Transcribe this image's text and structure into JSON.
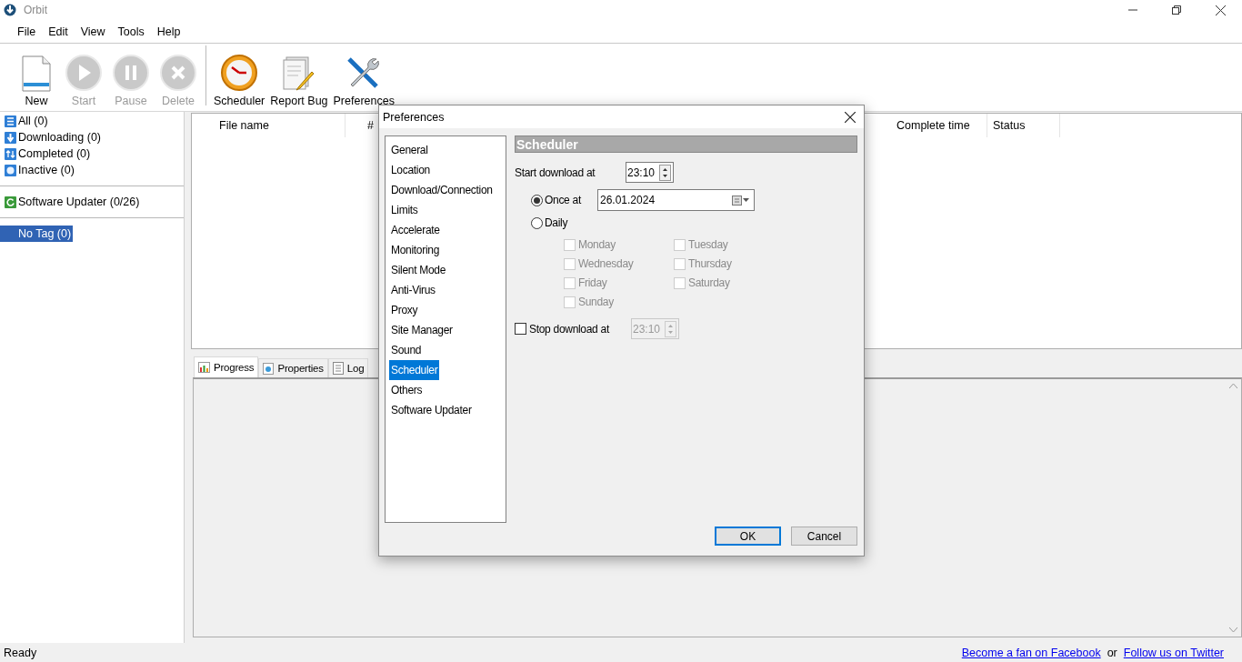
{
  "window": {
    "title": "Orbit"
  },
  "menu": [
    "File",
    "Edit",
    "View",
    "Tools",
    "Help"
  ],
  "toolbar": [
    {
      "label": "New",
      "disabled": false
    },
    {
      "label": "Start",
      "disabled": true
    },
    {
      "label": "Pause",
      "disabled": true
    },
    {
      "label": "Delete",
      "disabled": true
    },
    {
      "label": "Scheduler",
      "disabled": false
    },
    {
      "label": "Report Bug",
      "disabled": false
    },
    {
      "label": "Preferences",
      "disabled": false
    }
  ],
  "sidebar": {
    "categories": [
      {
        "label": "All (0)"
      },
      {
        "label": "Downloading (0)"
      },
      {
        "label": "Completed (0)"
      },
      {
        "label": "Inactive (0)"
      }
    ],
    "updater": {
      "label": "Software Updater (0/26)"
    },
    "tags": [
      {
        "label": "No Tag (0)",
        "selected": true
      }
    ]
  },
  "table": {
    "columns": [
      "File name",
      "#",
      "Complete time",
      "Status"
    ]
  },
  "detail_tabs": [
    {
      "label": "Progress",
      "selected": true
    },
    {
      "label": "Properties",
      "selected": false
    },
    {
      "label": "Log",
      "selected": false
    }
  ],
  "dialog": {
    "title": "Preferences",
    "nav": [
      {
        "label": "General",
        "selected": false
      },
      {
        "label": "Location",
        "selected": false
      },
      {
        "label": "Download/Connection",
        "selected": false
      },
      {
        "label": "Limits",
        "selected": false
      },
      {
        "label": "Accelerate",
        "selected": false
      },
      {
        "label": "Monitoring",
        "selected": false
      },
      {
        "label": "Silent Mode",
        "selected": false
      },
      {
        "label": "Anti-Virus",
        "selected": false
      },
      {
        "label": "Proxy",
        "selected": false
      },
      {
        "label": "Site Manager",
        "selected": false
      },
      {
        "label": "Sound",
        "selected": false
      },
      {
        "label": "Scheduler",
        "selected": true
      },
      {
        "label": "Others",
        "selected": false
      },
      {
        "label": "Software Updater",
        "selected": false
      }
    ],
    "section_title": "Scheduler",
    "start": {
      "label": "Start download at",
      "time": "23:10"
    },
    "modes": [
      {
        "label": "Once at",
        "selected": true,
        "date": "26.01.2024"
      },
      {
        "label": "Daily",
        "selected": false
      }
    ],
    "days": [
      {
        "label": "Monday",
        "checked": false,
        "disabled": true
      },
      {
        "label": "Tuesday",
        "checked": false,
        "disabled": true
      },
      {
        "label": "Wednesday",
        "checked": false,
        "disabled": true
      },
      {
        "label": "Thursday",
        "checked": false,
        "disabled": true
      },
      {
        "label": "Friday",
        "checked": false,
        "disabled": true
      },
      {
        "label": "Saturday",
        "checked": false,
        "disabled": true
      },
      {
        "label": "Sunday",
        "checked": false,
        "disabled": true
      }
    ],
    "stop": {
      "label": "Stop download at",
      "checked": false,
      "time": "23:10",
      "disabled": true
    },
    "buttons": [
      {
        "label": "OK",
        "default": true
      },
      {
        "label": "Cancel",
        "default": false
      }
    ]
  },
  "status_bar": {
    "text": "Ready",
    "links": [
      "Become a fan on Facebook",
      "Follow us on Twitter"
    ],
    "separator": "or"
  }
}
